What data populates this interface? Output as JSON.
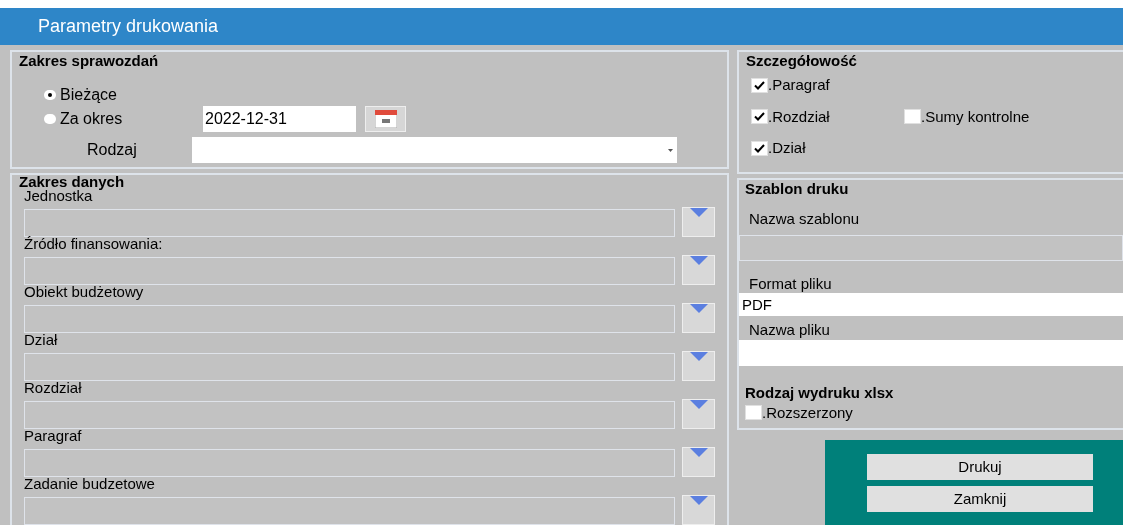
{
  "window": {
    "title": "Parametry drukowania"
  },
  "report_scope": {
    "title": "Zakres sprawozdań",
    "options": [
      {
        "label": "Bieżące",
        "selected": true
      },
      {
        "label": "Za okres",
        "selected": false
      }
    ],
    "date": "2022-12-31",
    "kind_label": "Rodzaj"
  },
  "detail": {
    "title": "Szczegółowość",
    "checks": [
      {
        "label": ".Paragraf",
        "checked": true
      },
      {
        "label": ".Rozdział",
        "checked": true
      },
      {
        "label": ".Sumy kontrolne",
        "checked": false
      },
      {
        "label": ".Dział",
        "checked": true
      }
    ]
  },
  "data_scope": {
    "title": "Zakres danych",
    "fields": [
      {
        "label": "Jednostka"
      },
      {
        "label": "Źródło finansowania:"
      },
      {
        "label": "Obiekt budżetowy"
      },
      {
        "label": "Dział"
      },
      {
        "label": "Rozdział"
      },
      {
        "label": "Paragraf"
      },
      {
        "label": "Zadanie budzetowe"
      }
    ]
  },
  "template": {
    "title": "Szablon druku",
    "name_label": "Nazwa szablonu",
    "format_label": "Format pliku",
    "format_value": "PDF",
    "file_label": "Nazwa pliku",
    "xlsx_title": "Rodzaj wydruku xlsx",
    "xlsx_checks": [
      {
        "label": ".Rozszerzony",
        "checked": false
      }
    ]
  },
  "buttons": [
    "Drukuj",
    "Zamknij"
  ]
}
